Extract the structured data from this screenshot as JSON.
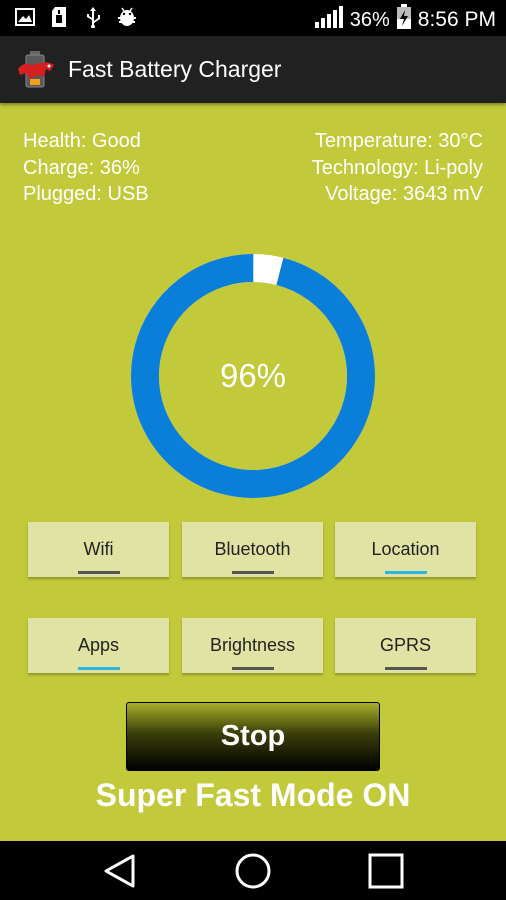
{
  "status_bar": {
    "icons": [
      "image-icon",
      "sd-card-icon",
      "usb-icon",
      "android-debug-icon"
    ],
    "battery_percent": "36%",
    "time": "8:56 PM"
  },
  "app_bar": {
    "title": "Fast Battery Charger",
    "logo": "battery-bull-logo"
  },
  "battery_info": {
    "left": [
      "Health: Good",
      "Charge: 36%",
      "Plugged: USB"
    ],
    "right": [
      "Temperature: 30°C",
      "Technology: Li-poly",
      "Voltage: 3643 mV"
    ]
  },
  "progress": {
    "label": "96%",
    "value": 0.96,
    "ring_color": "#0a7fd9",
    "gap_color": "#ffffff"
  },
  "toggles": [
    {
      "label": "Wifi",
      "active": false
    },
    {
      "label": "Bluetooth",
      "active": false
    },
    {
      "label": "Location",
      "active": true
    },
    {
      "label": "Apps",
      "active": true
    },
    {
      "label": "Brightness",
      "active": false
    },
    {
      "label": "GPRS",
      "active": false
    }
  ],
  "stop_button": {
    "label": "Stop"
  },
  "mode_text": "Super Fast Mode ON",
  "nav_bar": {
    "icons": [
      "back-icon",
      "home-icon",
      "recents-icon"
    ]
  },
  "colors": {
    "background": "#c2c93a",
    "app_bar": "#212121",
    "tile": "#e0e3a3",
    "indicator_on": "#29b6e0",
    "indicator_off": "#555555"
  }
}
